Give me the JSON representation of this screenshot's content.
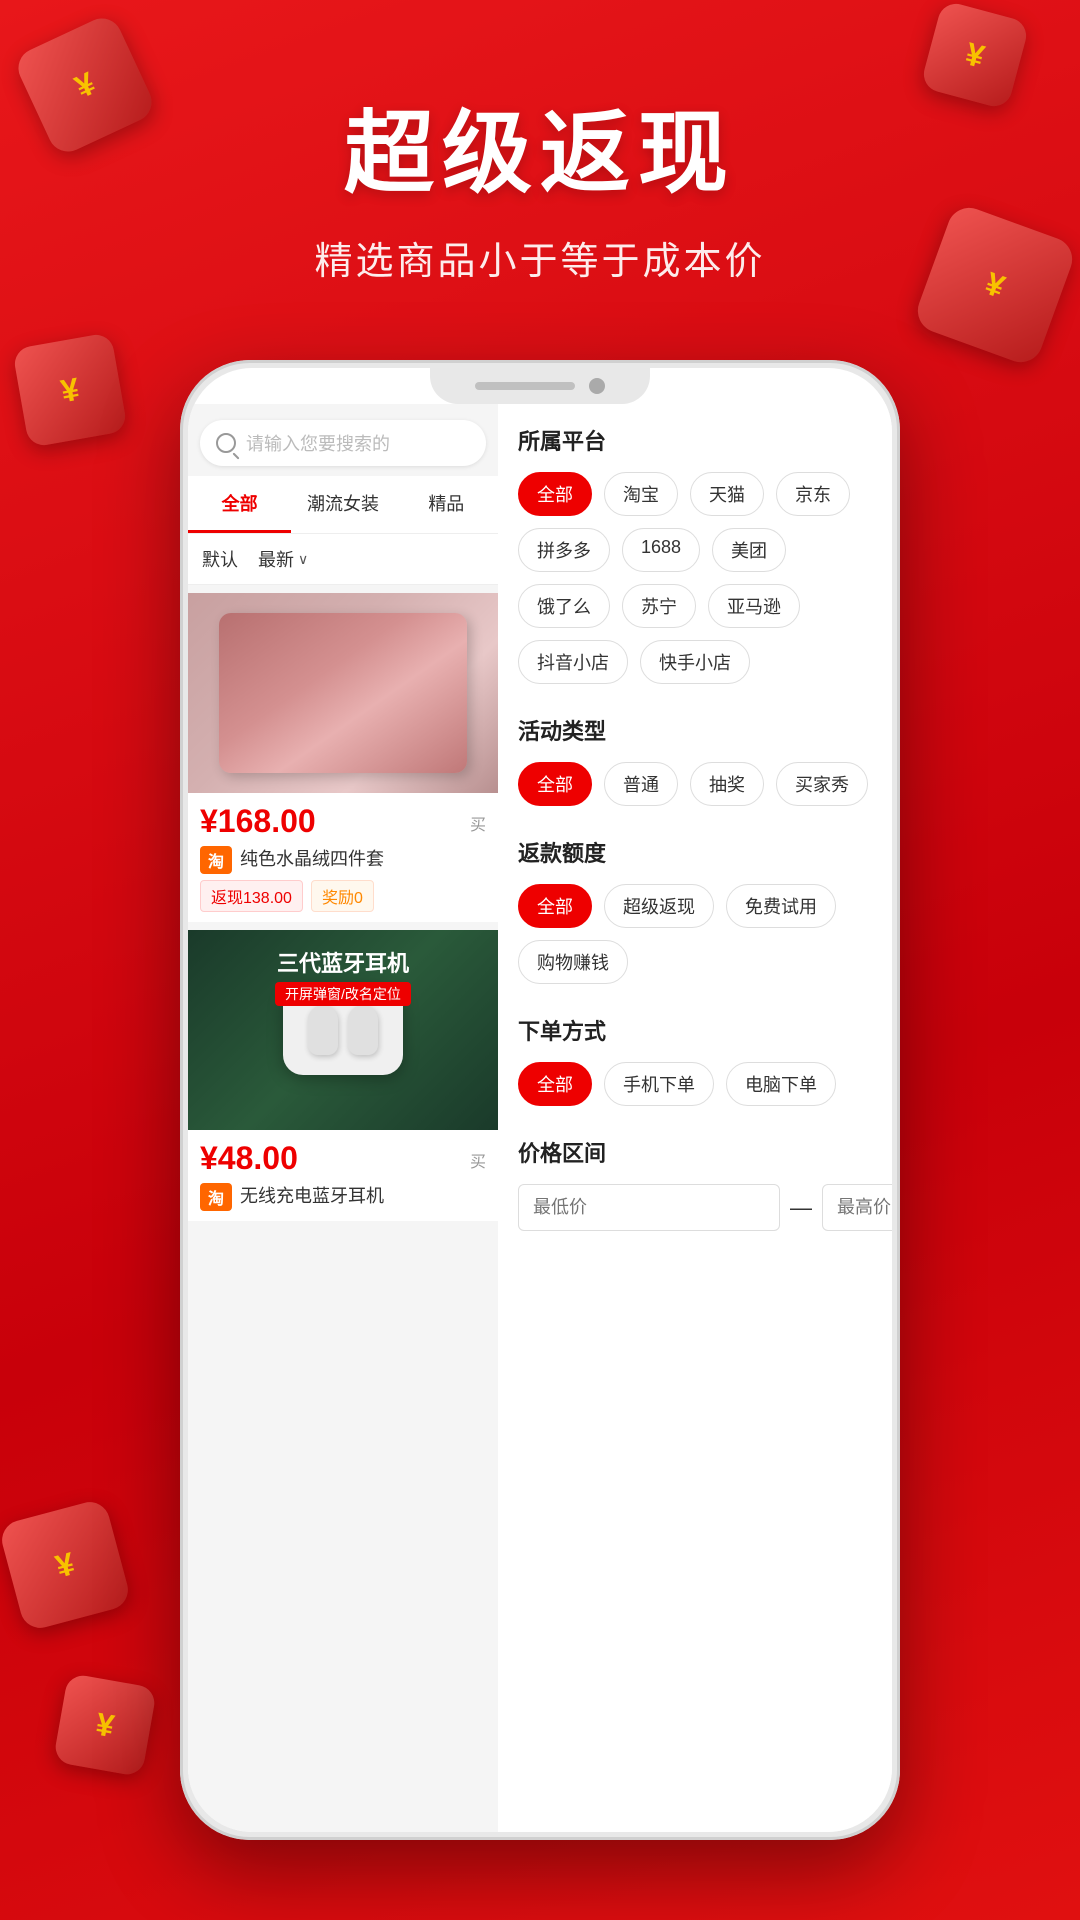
{
  "hero": {
    "title": "超级返现",
    "subtitle": "精选商品小于等于成本价"
  },
  "search": {
    "placeholder": "请输入您要搜索的"
  },
  "categories": [
    {
      "label": "全部",
      "active": true
    },
    {
      "label": "潮流女装",
      "active": false
    },
    {
      "label": "精品",
      "active": false
    }
  ],
  "sort": {
    "default_label": "默认",
    "latest_label": "最新"
  },
  "products": [
    {
      "price": "168.00",
      "buy_label": "买",
      "platform": "淘",
      "name": "纯色水晶绒四件套",
      "cashback": "返现138.00",
      "reward": "奖励0"
    },
    {
      "price": "48.00",
      "buy_label": "买",
      "platform": "淘",
      "name": "无线充电蓝牙耳机",
      "banner_title": "三代蓝牙耳机",
      "banner_sub": "开屏弹窗/改名定位"
    }
  ],
  "filter": {
    "platform_section": {
      "title": "所属平台",
      "tags": [
        {
          "label": "全部",
          "active": true
        },
        {
          "label": "淘宝",
          "active": false
        },
        {
          "label": "天猫",
          "active": false
        },
        {
          "label": "京东",
          "active": false
        },
        {
          "label": "拼多多",
          "active": false
        },
        {
          "label": "1688",
          "active": false
        },
        {
          "label": "美团",
          "active": false
        },
        {
          "label": "饿了么",
          "active": false
        },
        {
          "label": "苏宁",
          "active": false
        },
        {
          "label": "亚马逊",
          "active": false
        },
        {
          "label": "抖音小店",
          "active": false
        },
        {
          "label": "快手小店",
          "active": false
        }
      ]
    },
    "activity_section": {
      "title": "活动类型",
      "tags": [
        {
          "label": "全部",
          "active": true
        },
        {
          "label": "普通",
          "active": false
        },
        {
          "label": "抽奖",
          "active": false
        },
        {
          "label": "买家秀",
          "active": false
        }
      ]
    },
    "cashback_section": {
      "title": "返款额度",
      "tags": [
        {
          "label": "全部",
          "active": true
        },
        {
          "label": "超级返现",
          "active": false
        },
        {
          "label": "免费试用",
          "active": false
        },
        {
          "label": "购物赚钱",
          "active": false
        }
      ]
    },
    "order_section": {
      "title": "下单方式",
      "tags": [
        {
          "label": "全部",
          "active": true
        },
        {
          "label": "手机下单",
          "active": false
        },
        {
          "label": "电脑下单",
          "active": false
        }
      ]
    },
    "price_section": {
      "title": "价格区间",
      "min_placeholder": "最低价",
      "max_placeholder": "最高价",
      "separator": "—"
    }
  },
  "decorations": {
    "yen": "¥"
  }
}
